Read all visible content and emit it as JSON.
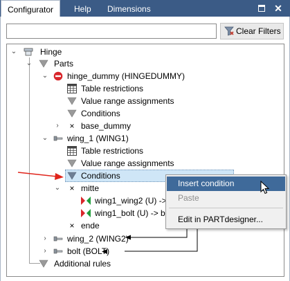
{
  "tabs": [
    {
      "label": "Configurator"
    },
    {
      "label": "Help"
    },
    {
      "label": "Dimensions"
    }
  ],
  "search": {
    "value": "",
    "placeholder": ""
  },
  "clear_filters_label": "Clear Filters",
  "tree": {
    "hinge": "Hinge",
    "parts": "Parts",
    "hinge_dummy": "hinge_dummy (HINGEDUMMY)",
    "table_restrictions_1": "Table restrictions",
    "value_range_1": "Value range assignments",
    "conditions_1": "Conditions",
    "base_dummy": "base_dummy",
    "wing_1": "wing_1 (WING1)",
    "table_restrictions_2": "Table restrictions",
    "value_range_2": "Value range assignments",
    "conditions_2": "Conditions",
    "mitte": "mitte",
    "wing1_wing2": "wing1_wing2 (U) ->",
    "wing1_bolt": "wing1_bolt (U) -> b",
    "ende": "ende",
    "wing_2": "wing_2 (WING2)",
    "bolt": "bolt (BOLT)",
    "additional_rules": "Additional rules"
  },
  "context_menu": {
    "insert_condition": "Insert condition",
    "paste": "Paste",
    "edit_in_partdesigner": "Edit in PARTdesigner..."
  },
  "colors": {
    "tabbar": "#3b5b86",
    "arrow": "#e0241b",
    "menu_hover": "#3f6a9a"
  }
}
